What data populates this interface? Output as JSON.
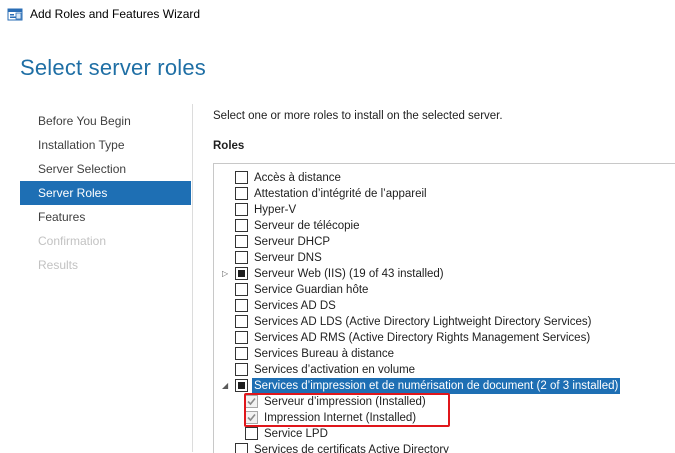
{
  "window": {
    "title": "Add Roles and Features Wizard"
  },
  "page": {
    "title": "Select server roles"
  },
  "nav": {
    "items": [
      {
        "label": "Before You Begin",
        "state": "normal"
      },
      {
        "label": "Installation Type",
        "state": "normal"
      },
      {
        "label": "Server Selection",
        "state": "normal"
      },
      {
        "label": "Server Roles",
        "state": "active"
      },
      {
        "label": "Features",
        "state": "normal"
      },
      {
        "label": "Confirmation",
        "state": "disabled"
      },
      {
        "label": "Results",
        "state": "disabled"
      }
    ]
  },
  "content": {
    "intro": "Select one or more roles to install on the selected server.",
    "roles_label": "Roles"
  },
  "roles": [
    {
      "label": "Accès à distance",
      "checked": "none"
    },
    {
      "label": "Attestation d’intégrité de l’appareil",
      "checked": "none"
    },
    {
      "label": "Hyper-V",
      "checked": "none"
    },
    {
      "label": "Serveur de télécopie",
      "checked": "none"
    },
    {
      "label": "Serveur DHCP",
      "checked": "none"
    },
    {
      "label": "Serveur DNS",
      "checked": "none"
    },
    {
      "label": "Serveur Web (IIS) (19 of 43 installed)",
      "checked": "partial",
      "expander": "collapsed"
    },
    {
      "label": "Service Guardian hôte",
      "checked": "none"
    },
    {
      "label": "Services AD DS",
      "checked": "none"
    },
    {
      "label": "Services AD LDS (Active Directory Lightweight Directory Services)",
      "checked": "none"
    },
    {
      "label": "Services AD RMS (Active Directory Rights Management Services)",
      "checked": "none"
    },
    {
      "label": "Services Bureau à distance",
      "checked": "none"
    },
    {
      "label": "Services d’activation en volume",
      "checked": "none"
    },
    {
      "label": "Services d’impression et de numérisation de document (2 of 3 installed)",
      "checked": "partial",
      "expander": "expanded",
      "selected": true
    },
    {
      "label": "Serveur d’impression (Installed)",
      "checked": "installed",
      "child": true
    },
    {
      "label": "Impression Internet (Installed)",
      "checked": "installed",
      "child": true
    },
    {
      "label": "Service LPD",
      "checked": "none",
      "child": true
    },
    {
      "label": "Services de certificats Active Directory",
      "checked": "none"
    }
  ],
  "colors": {
    "accent": "#1e6fb4",
    "title": "#1f6fa5",
    "highlight": "#e0161b"
  },
  "icons": {
    "app": "wizard-app-icon",
    "collapsed": "triangle-right-icon",
    "expanded": "triangle-down-icon"
  }
}
